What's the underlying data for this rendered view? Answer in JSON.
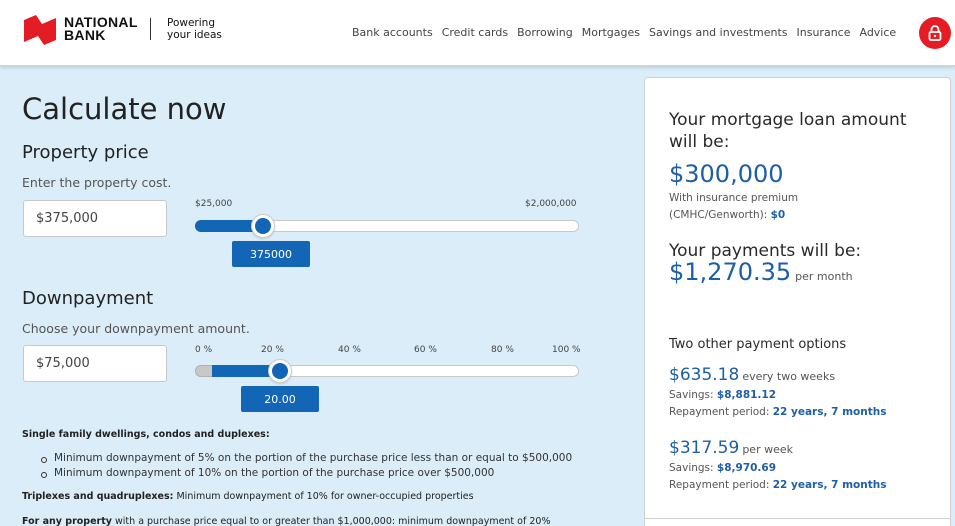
{
  "header": {
    "logo": {
      "line1": "NATIONAL",
      "line2": "BANK"
    },
    "tagline": {
      "line1": "Powering",
      "line2": "your ideas"
    },
    "nav": [
      "Bank accounts",
      "Credit cards",
      "Borrowing",
      "Mortgages",
      "Savings and investments",
      "Insurance",
      "Advice"
    ],
    "lock_icon": "lock-icon",
    "brand_color": "#e41c23"
  },
  "calculator": {
    "title": "Calculate now",
    "property": {
      "heading": "Property price",
      "hint": "Enter the property cost.",
      "input_value": "$375,000",
      "min_label": "$25,000",
      "max_label": "$2,000,000",
      "slider_value": "375000",
      "slider_fraction": 0.177
    },
    "downpayment": {
      "heading": "Downpayment",
      "hint": "Choose your downpayment amount.",
      "input_value": "$75,000",
      "ticks": [
        "0 %",
        "20 %",
        "40 %",
        "60 %",
        "80 %",
        "100 %"
      ],
      "slider_value": "20.00",
      "slider_percent": 20
    },
    "notes": {
      "single_label": "Single family dwellings, condos and duplexes:",
      "bullets": [
        "Minimum downpayment of 5% on the portion of the purchase price less than or equal to $500,000",
        "Minimum downpayment of 10% on the portion of the purchase price over $500,000"
      ],
      "triplex_label": "Triplexes and quadruplexes:",
      "triplex_text": "Minimum downpayment of 10% for owner-occupied properties",
      "any_label": "For any property",
      "any_text": "with a purchase price equal to or greater than $1,000,000: minimum downpayment of 20%"
    }
  },
  "results": {
    "loan_title": "Your mortgage loan amount will be:",
    "loan_amount": "$300,000",
    "premium_label_1": "With insurance premium",
    "premium_label_2": "(CMHC/Genworth):",
    "premium_value": "$0",
    "payments_title": "Your payments will be:",
    "payment_amount": "$1,270.35",
    "payment_unit": "per month",
    "other_title": "Two other payment options",
    "options": [
      {
        "amount": "$635.18",
        "unit": "every two weeks",
        "savings_label": "Savings:",
        "savings": "$8,881.12",
        "period_label": "Repayment period:",
        "period": "22 years, 7 months"
      },
      {
        "amount": "$317.59",
        "unit": "per week",
        "savings_label": "Savings:",
        "savings": "$8,970.69",
        "period_label": "Repayment period:",
        "period": "22 years, 7 months"
      }
    ]
  }
}
